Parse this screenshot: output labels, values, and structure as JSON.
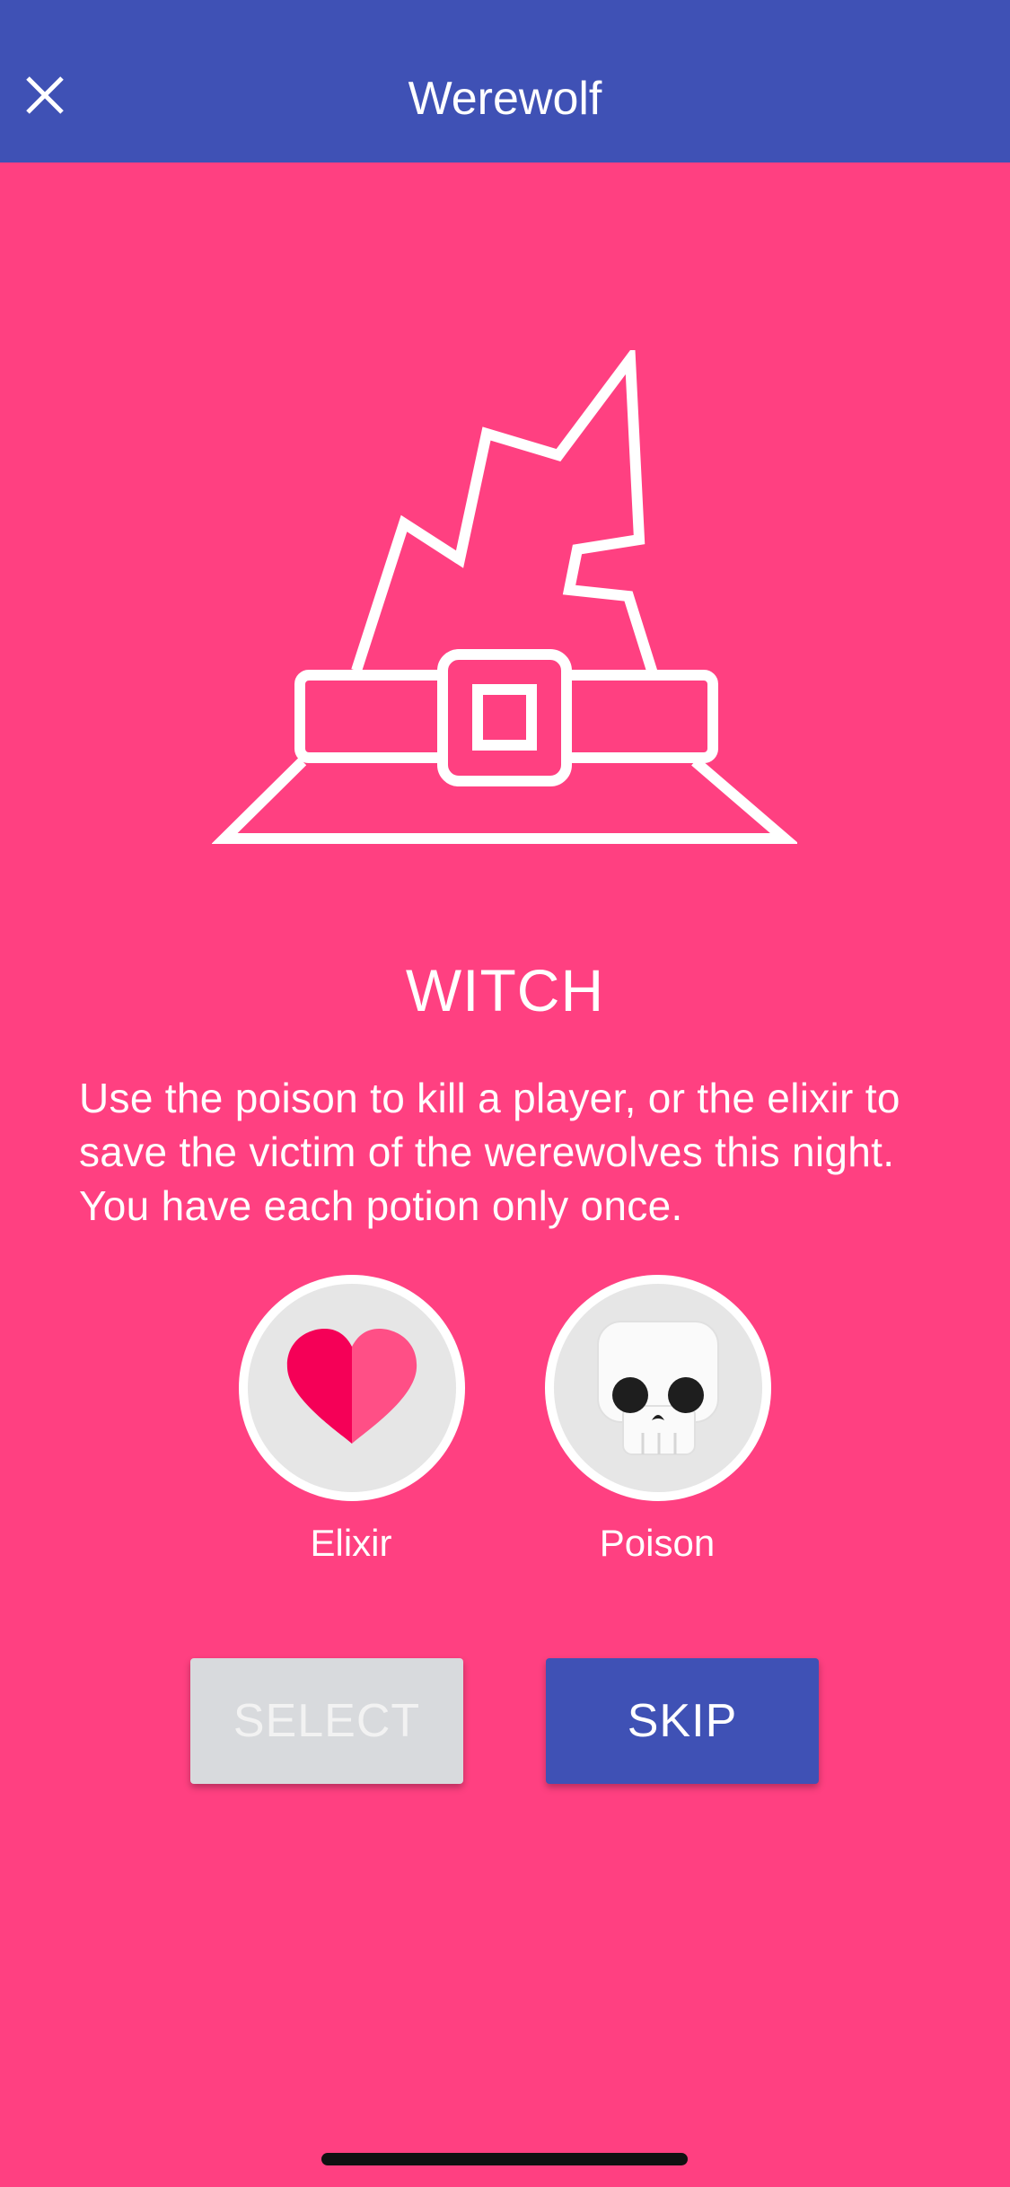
{
  "app_bar": {
    "title": "Werewolf",
    "close_icon": "close-icon",
    "background": "#3f51b5"
  },
  "role": {
    "icon": "witch-hat-icon",
    "name": "WITCH",
    "description": "Use the poison to kill a player, or the elixir to save the victim of the werewolves this night. You have each potion only once."
  },
  "potions": [
    {
      "label": "Elixir",
      "icon": "heart-icon"
    },
    {
      "label": "Poison",
      "icon": "skull-icon"
    }
  ],
  "actions": {
    "select_label": "SELECT",
    "skip_label": "SKIP",
    "select_enabled": false
  },
  "colors": {
    "background": "#ff4081",
    "accent": "#3f51b5",
    "disabled": "#d8dadd"
  }
}
